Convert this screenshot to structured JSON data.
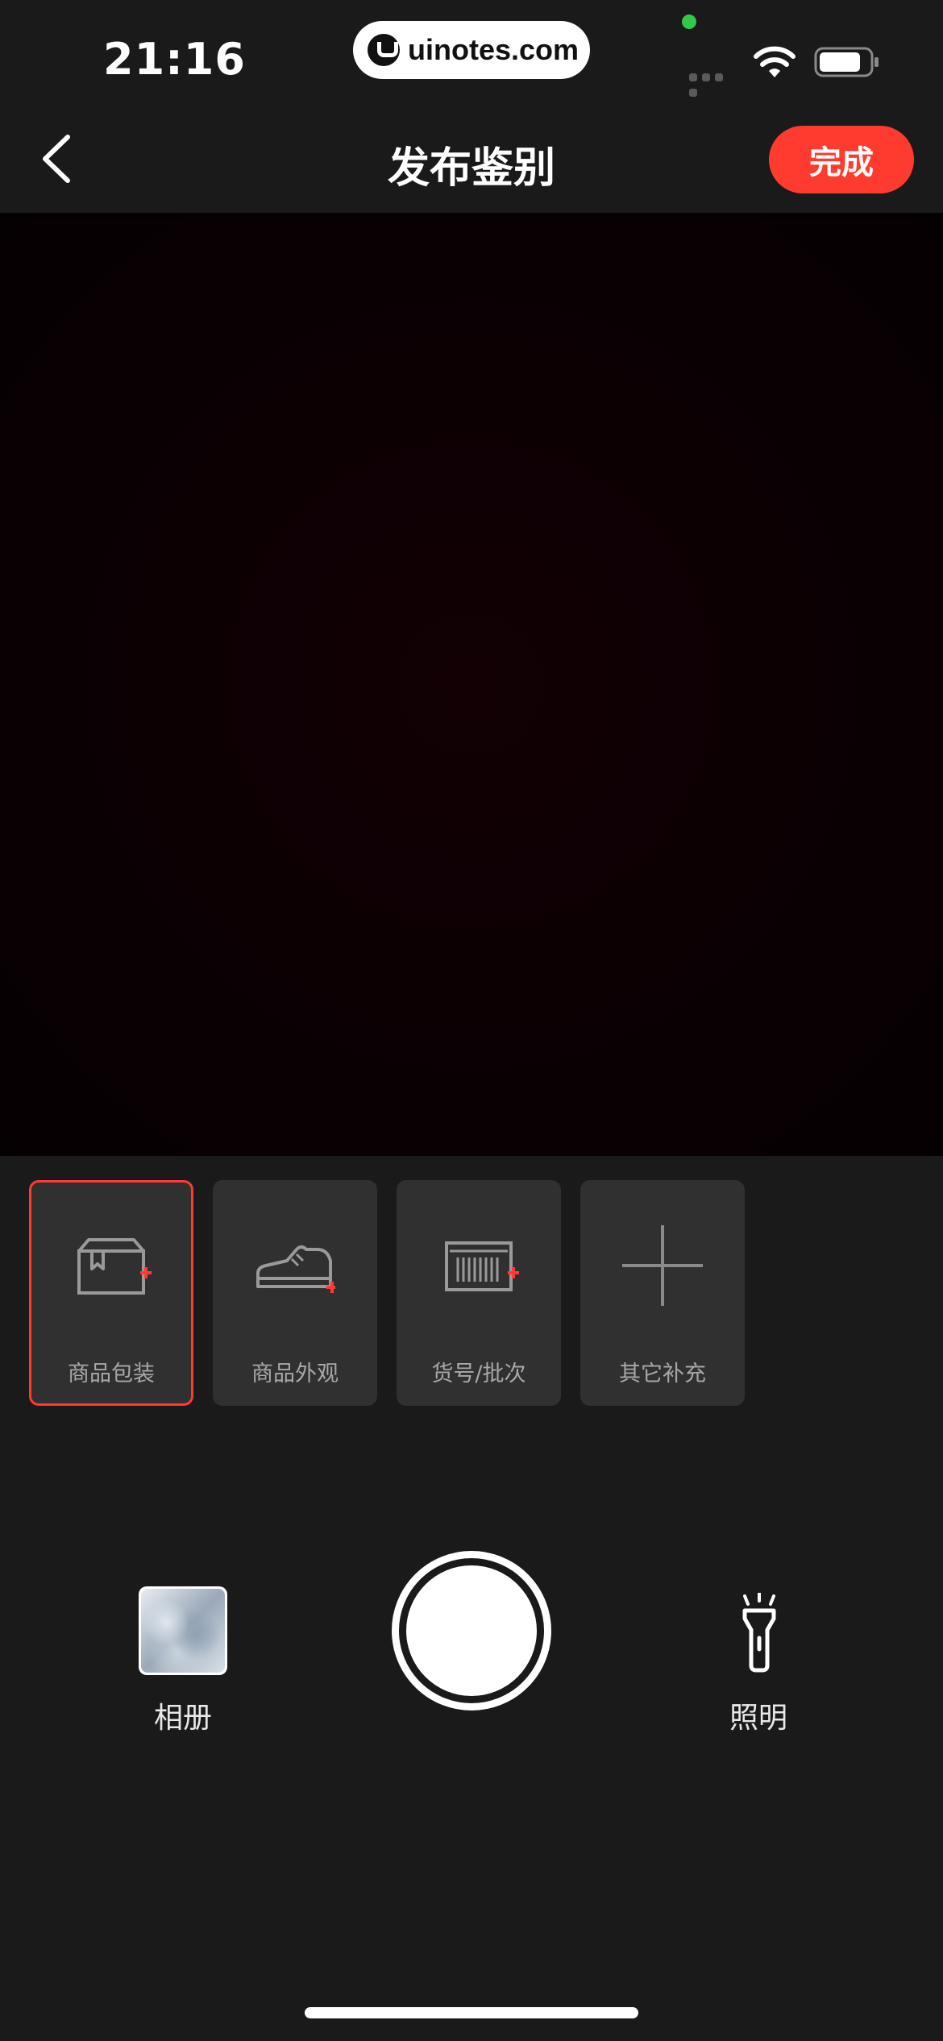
{
  "status_bar": {
    "time": "21:16",
    "watermark": "uinotes.com",
    "wifi_icon": "wifi-icon",
    "battery_icon": "battery-icon",
    "signal_icon": "cellular-signal-icon",
    "privacy_indicator_color": "#30c94a"
  },
  "nav": {
    "back_icon": "chevron-left-icon",
    "title": "发布鉴别",
    "done_label": "完成"
  },
  "colors": {
    "accent": "#ff3b30",
    "background": "#1a1a1a",
    "card_background": "#303030",
    "card_label": "#a8a8a8"
  },
  "categories": [
    {
      "label": "商品包装",
      "icon": "package-box-icon",
      "selected": true
    },
    {
      "label": "商品外观",
      "icon": "sneaker-icon",
      "selected": false
    },
    {
      "label": "货号/批次",
      "icon": "barcode-label-icon",
      "selected": false
    },
    {
      "label": "其它补充",
      "icon": "plus-icon",
      "selected": false
    }
  ],
  "controls": {
    "album_label": "相册",
    "shutter_icon": "shutter-button-icon",
    "flashlight_label": "照明",
    "flashlight_icon": "flashlight-icon"
  }
}
